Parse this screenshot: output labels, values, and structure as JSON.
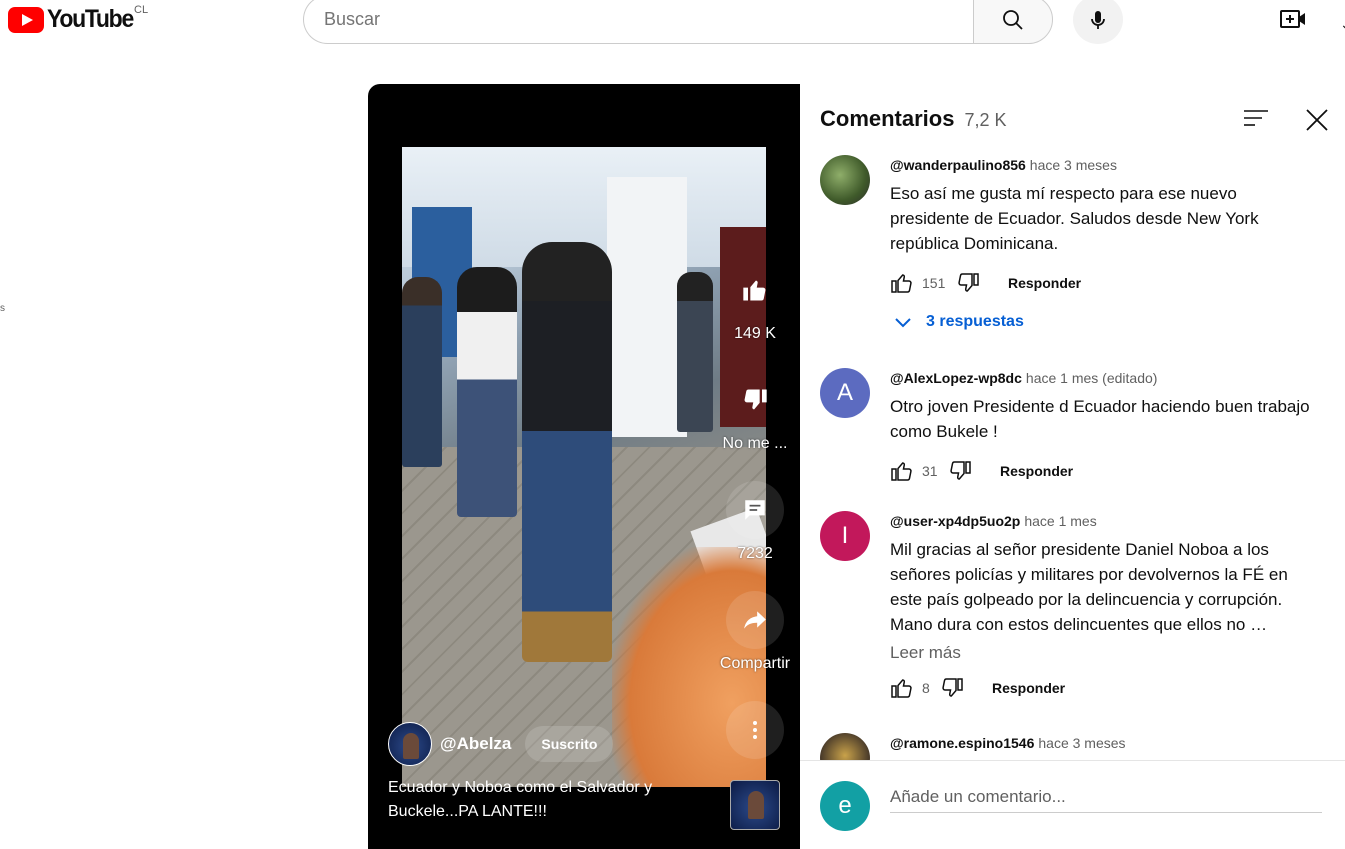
{
  "header": {
    "logo_text": "YouTube",
    "country_code": "CL",
    "search_placeholder": "Buscar"
  },
  "edge_text": "s",
  "player": {
    "actions": {
      "like_count": "149 K",
      "dislike_label": "No me ...",
      "comment_count": "7232",
      "share_label": "Compartir"
    },
    "channel_name": "@Abelza",
    "subscribed_label": "Suscrito",
    "video_title": "Ecuador y Noboa como el Salvador y Buckele...PA LANTE!!!"
  },
  "comments_panel": {
    "title": "Comentarios",
    "count": "7,2 K",
    "comments": [
      {
        "author": "@wanderpaulino856",
        "time": "hace 3 meses",
        "text": "Eso así me gusta mí respecto para ese nuevo presidente de Ecuador. Saludos desde New York república Dominicana.",
        "likes": "151",
        "reply_label": "Responder",
        "replies_label": "3 respuestas",
        "avatar_letter": ""
      },
      {
        "author": "@AlexLopez-wp8dc",
        "time": "hace 1 mes (editado)",
        "text": "Otro joven Presidente d Ecuador haciendo buen trabajo como Bukele !",
        "likes": "31",
        "reply_label": "Responder",
        "avatar_letter": "A",
        "avatar_color": "#5c6bc0"
      },
      {
        "author": "@user-xp4dp5uo2p",
        "time": "hace 1 mes",
        "text": "Mil gracias al señor presidente Daniel Noboa a los señores policías y militares por devolvernos la FÉ en este país golpeado por la delincuencia y corrupción. Mano dura con estos delincuentes que ellos no …",
        "read_more": "Leer más",
        "likes": "8",
        "reply_label": "Responder",
        "avatar_letter": "I",
        "avatar_color": "#c2185b"
      },
      {
        "author": "@ramone.espino1546",
        "time": "hace 3 meses"
      }
    ],
    "add_comment": {
      "avatar_letter": "e",
      "placeholder": "Añade un comentario..."
    }
  }
}
